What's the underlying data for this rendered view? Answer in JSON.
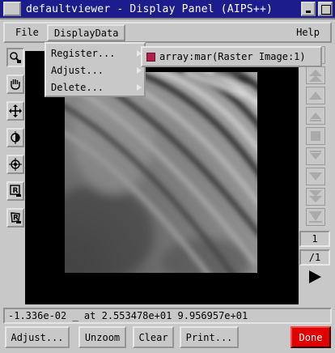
{
  "window": {
    "title": "defaultviewer - Display Panel (AIPS++)"
  },
  "menubar": {
    "file": "File",
    "displaydata": "DisplayData",
    "help": "Help"
  },
  "displaydata_menu": {
    "items": [
      {
        "label": "Register..."
      },
      {
        "label": "Adjust..."
      },
      {
        "label": "Delete..."
      }
    ]
  },
  "register_submenu": {
    "item": "array:mar(Raster Image:1)",
    "checked": true,
    "check_color": "#b0204a"
  },
  "tools": [
    "zoom-tool-icon",
    "pan-hand-tool-icon",
    "move-crosshair-tool-icon",
    "color-adjust-tool-icon",
    "crosshair-position-tool-icon",
    "rectangle-region-tool-icon",
    "polygon-region-tool-icon"
  ],
  "animator": {
    "frame": "1",
    "total_frames": "/1"
  },
  "status": {
    "text": "-1.336e-02 _ at 2.553478e+01 9.956957e+01"
  },
  "buttons": {
    "adjust": "Adjust...",
    "unzoom": "Unzoom",
    "clear": "Clear",
    "print": "Print...",
    "done": "Done"
  },
  "colors": {
    "titlebar": "#1c1c8c",
    "done": "#e00000",
    "background": "#c8c8c8"
  }
}
